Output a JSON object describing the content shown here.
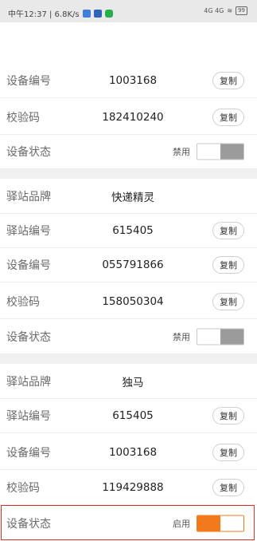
{
  "status_bar": {
    "left_text": "中午12:37 | 6.8K/s",
    "right_signal": "4G 4G",
    "battery": "99"
  },
  "copy_label": "复制",
  "section1": {
    "device_no_label": "设备编号",
    "device_no": "1003168",
    "check_code_label": "校验码",
    "check_code": "182410240",
    "device_status_label": "设备状态",
    "device_status": "禁用"
  },
  "section2": {
    "brand_label": "驿站品牌",
    "brand": "快递精灵",
    "station_no_label": "驿站编号",
    "station_no": "615405",
    "device_no_label": "设备编号",
    "device_no": "055791866",
    "check_code_label": "校验码",
    "check_code": "158050304",
    "device_status_label": "设备状态",
    "device_status": "禁用"
  },
  "section3": {
    "brand_label": "驿站品牌",
    "brand": "独马",
    "station_no_label": "驿站编号",
    "station_no": "615405",
    "device_no_label": "设备编号",
    "device_no": "1003168",
    "check_code_label": "校验码",
    "check_code": "119429888",
    "device_status_label": "设备状态",
    "device_status": "启用"
  }
}
